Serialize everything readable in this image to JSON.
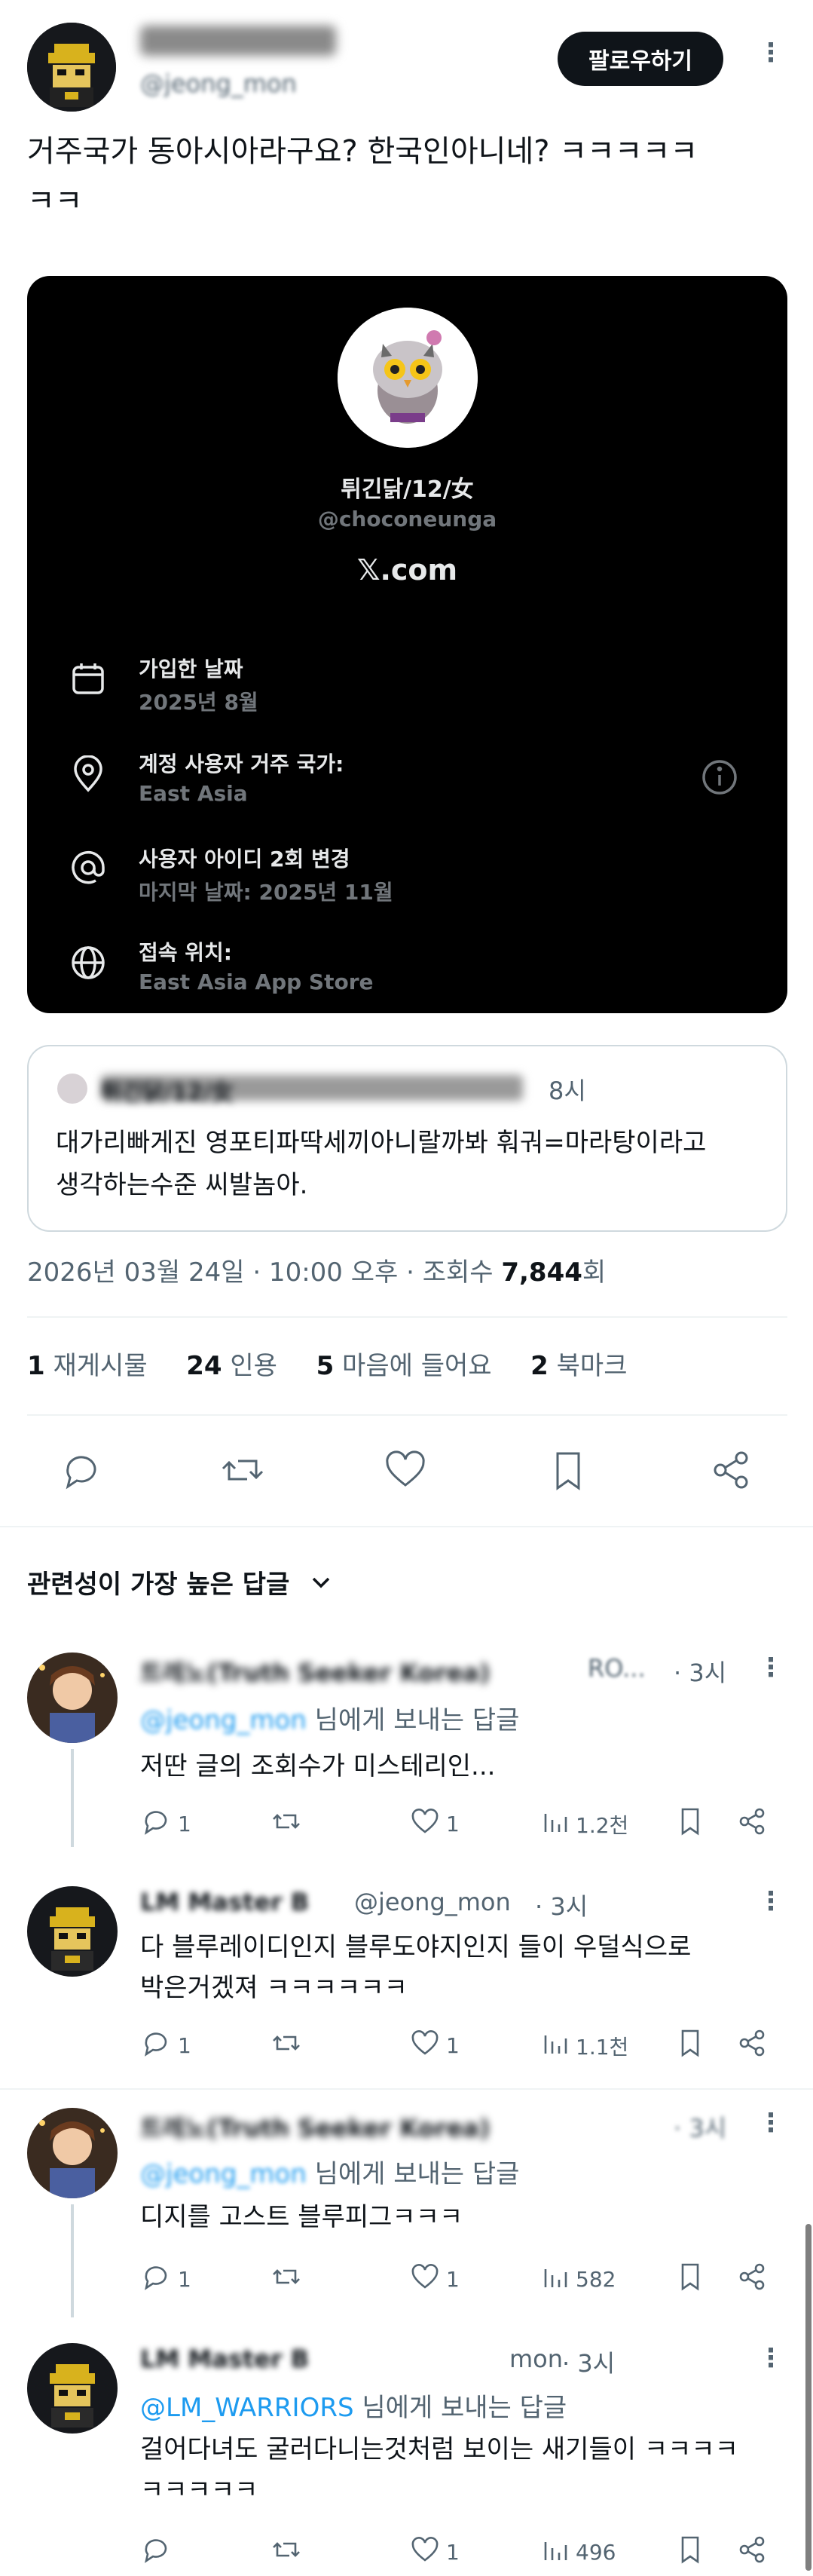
{
  "header": {
    "author_name": "",
    "author_handle": "@jeong_mon",
    "follow_label": "팔로우하기",
    "more_icon": "more-vertical-icon"
  },
  "post": {
    "text_line1": "거주국가 동아시아라구요? 한국인아니네? ㅋㅋㅋㅋㅋ",
    "text_line2": "ㅋㅋ"
  },
  "profile_card": {
    "display_name": "튀긴닭/12/女",
    "handle": "@choconeunga",
    "site": "𝕏.com",
    "rows": [
      {
        "icon": "calendar-icon",
        "label": "가입한 날짜",
        "sub": "2025년 8월"
      },
      {
        "icon": "location-pin-icon",
        "label": "계정 사용자 거주 국가:",
        "sub": "East Asia"
      },
      {
        "icon": "at-sign-icon",
        "label": "사용자 아이디 2회 변경",
        "sub": "마지막 날짜: 2025년 11월"
      },
      {
        "icon": "globe-icon",
        "label": "접속 위치:",
        "sub": "East Asia App Store"
      }
    ],
    "info_icon": "info-icon"
  },
  "quote": {
    "author": "튀긴닭/12/女",
    "time": "8시",
    "text_line1": "대가리빠게진 영포티파딱세끼아니랄까봐 훠궈=마라탕이라고",
    "text_line2": "생각하는수준 씨발놈아."
  },
  "meta": {
    "timestamp": "2026년 03월 24일 · 10:00 오후 · 조회수 ",
    "views": "7,844",
    "views_unit": "회"
  },
  "stats": {
    "reposts_count": "1",
    "reposts_label": "재게시물",
    "quotes_count": "24",
    "quotes_label": "인용",
    "likes_count": "5",
    "likes_label": "마음에 들어요",
    "bookmarks_count": "2",
    "bookmarks_label": "북마크"
  },
  "sort": {
    "label": "관련성이 가장 높은 답글"
  },
  "replies": [
    {
      "name": "트레노(Truth Seeker Korea)",
      "handle_tail": "RO...",
      "time": "· 3시",
      "reply_to_prefix": "@jeong_mon",
      "reply_to_suffix": " 님에게 보내는 답글",
      "text_line1": "저딴 글의 조회수가 미스테리인...",
      "text_line2": "",
      "comments": "1",
      "likes": "1",
      "views": "1.2천"
    },
    {
      "name": "LM Master B",
      "handle_tail": "@jeong_mon",
      "time": "· 3시",
      "reply_to_prefix": "",
      "reply_to_suffix": "",
      "text_line1": "다 블루레이디인지 블루도야지인지 들이 우덜식으로",
      "text_line2": "박은거겠져 ㅋㅋㅋㅋㅋㅋ",
      "comments": "1",
      "likes": "1",
      "views": "1.1천"
    },
    {
      "name": "트레노(Truth Seeker Korea)",
      "handle_tail": "",
      "time": "· 3시",
      "reply_to_prefix": "@jeong_mon",
      "reply_to_suffix": " 님에게 보내는 답글",
      "text_line1": "디지를 고스트 블루피그ㅋㅋㅋ",
      "text_line2": "",
      "comments": "1",
      "likes": "1",
      "views": "582"
    },
    {
      "name": "LM Master B",
      "handle_tail": "mon",
      "time": "· 3시",
      "reply_to_prefix": "@LM_WARRIORS",
      "reply_to_suffix": " 님에게 보내는 답글",
      "text_line1": "걸어다녀도 굴러다니는것처럼 보이는 새기들이 ㅋㅋㅋㅋ",
      "text_line2": "ㅋㅋㅋㅋㅋ",
      "comments": "",
      "likes": "1",
      "views": "496"
    }
  ]
}
